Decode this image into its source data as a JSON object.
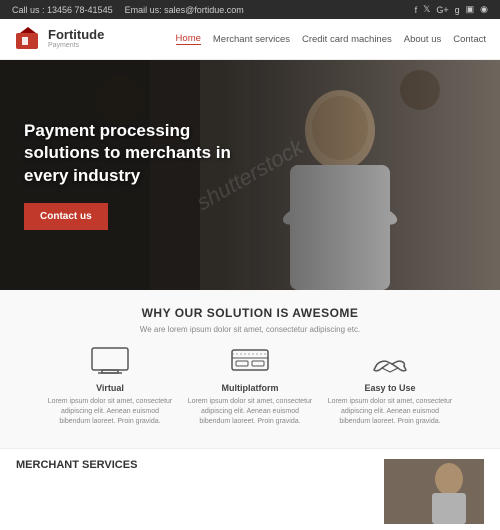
{
  "topbar": {
    "phone_label": "Call us : 13456 78-41545",
    "email_label": "Email us: sales@fortidue.com",
    "social_icons": [
      "f",
      "t",
      "G+",
      "g",
      "in",
      "📷",
      "rss"
    ]
  },
  "navbar": {
    "logo_main": "Fortitude",
    "logo_sub": "Payments",
    "links": [
      {
        "label": "Home",
        "active": true
      },
      {
        "label": "Merchant services",
        "active": false
      },
      {
        "label": "Credit card machines",
        "active": false
      },
      {
        "label": "About us",
        "active": false
      },
      {
        "label": "Contact",
        "active": false
      }
    ]
  },
  "hero": {
    "title": "Payment processing solutions to merchants in every industry",
    "cta_label": "Contact us",
    "watermark": "shutterstock"
  },
  "why": {
    "section_title": "WHY OUR SOLUTION IS AWESOME",
    "subtitle": "We are lorem ipsum dolor sit amet, consectetur adipiscing etc.",
    "features": [
      {
        "label": "Virtual",
        "desc": "Lorem ipsum dolor sit amet, consectetur adipiscing elit. Aenean euismod bibendum laoreet. Proin gravida."
      },
      {
        "label": "Multiplatform",
        "desc": "Lorem ipsum dolor sit amet, consectetur adipiscing elit. Aenean euismod bibendum laoreet. Proin gravida."
      },
      {
        "label": "Easy to Use",
        "desc": "Lorem ipsum dolor sit amet, consectetur adipiscing elit. Aenean euismod bibendum laoreet. Proin gravida."
      }
    ]
  },
  "merchant": {
    "title": "MERCHANT SERVICES"
  }
}
